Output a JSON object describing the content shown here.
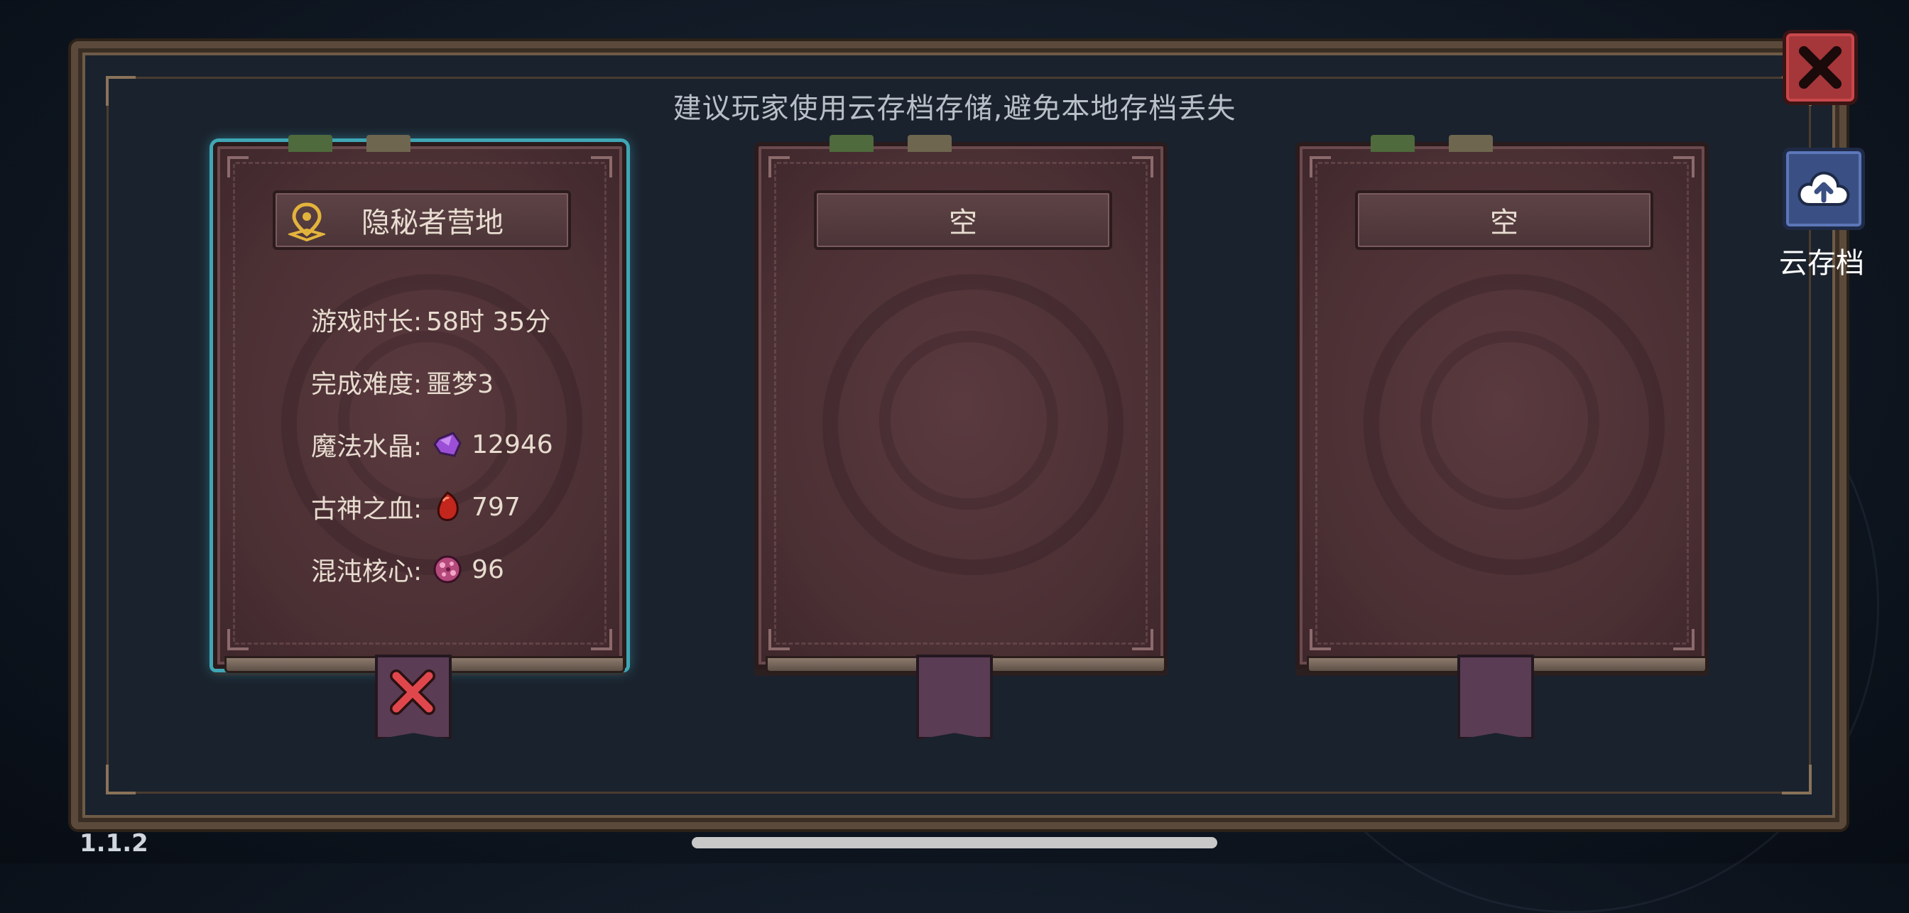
{
  "notice": "建议玩家使用云存档存储,避免本地存档丢失",
  "slots": [
    {
      "title": "隐秘者营地",
      "stats": [
        {
          "label": "游戏时长:",
          "value": "58时 35分",
          "icon": ""
        },
        {
          "label": "完成难度:",
          "value": "噩梦3",
          "icon": ""
        },
        {
          "label": "魔法水晶:",
          "value": "12946",
          "icon": "purple-crystal-icon"
        },
        {
          "label": "古神之血:",
          "value": "797",
          "icon": "red-blood-icon"
        },
        {
          "label": "混沌核心:",
          "value": "96",
          "icon": "chaos-core-icon"
        }
      ]
    },
    {
      "title": "空"
    },
    {
      "title": "空"
    }
  ],
  "cloud_save_label": "云存档",
  "version": "1.1.2",
  "colors": {
    "selected_glow": "#3fa6b4",
    "close_red": "#a5363a",
    "cloud_blue": "#3a4f83"
  }
}
